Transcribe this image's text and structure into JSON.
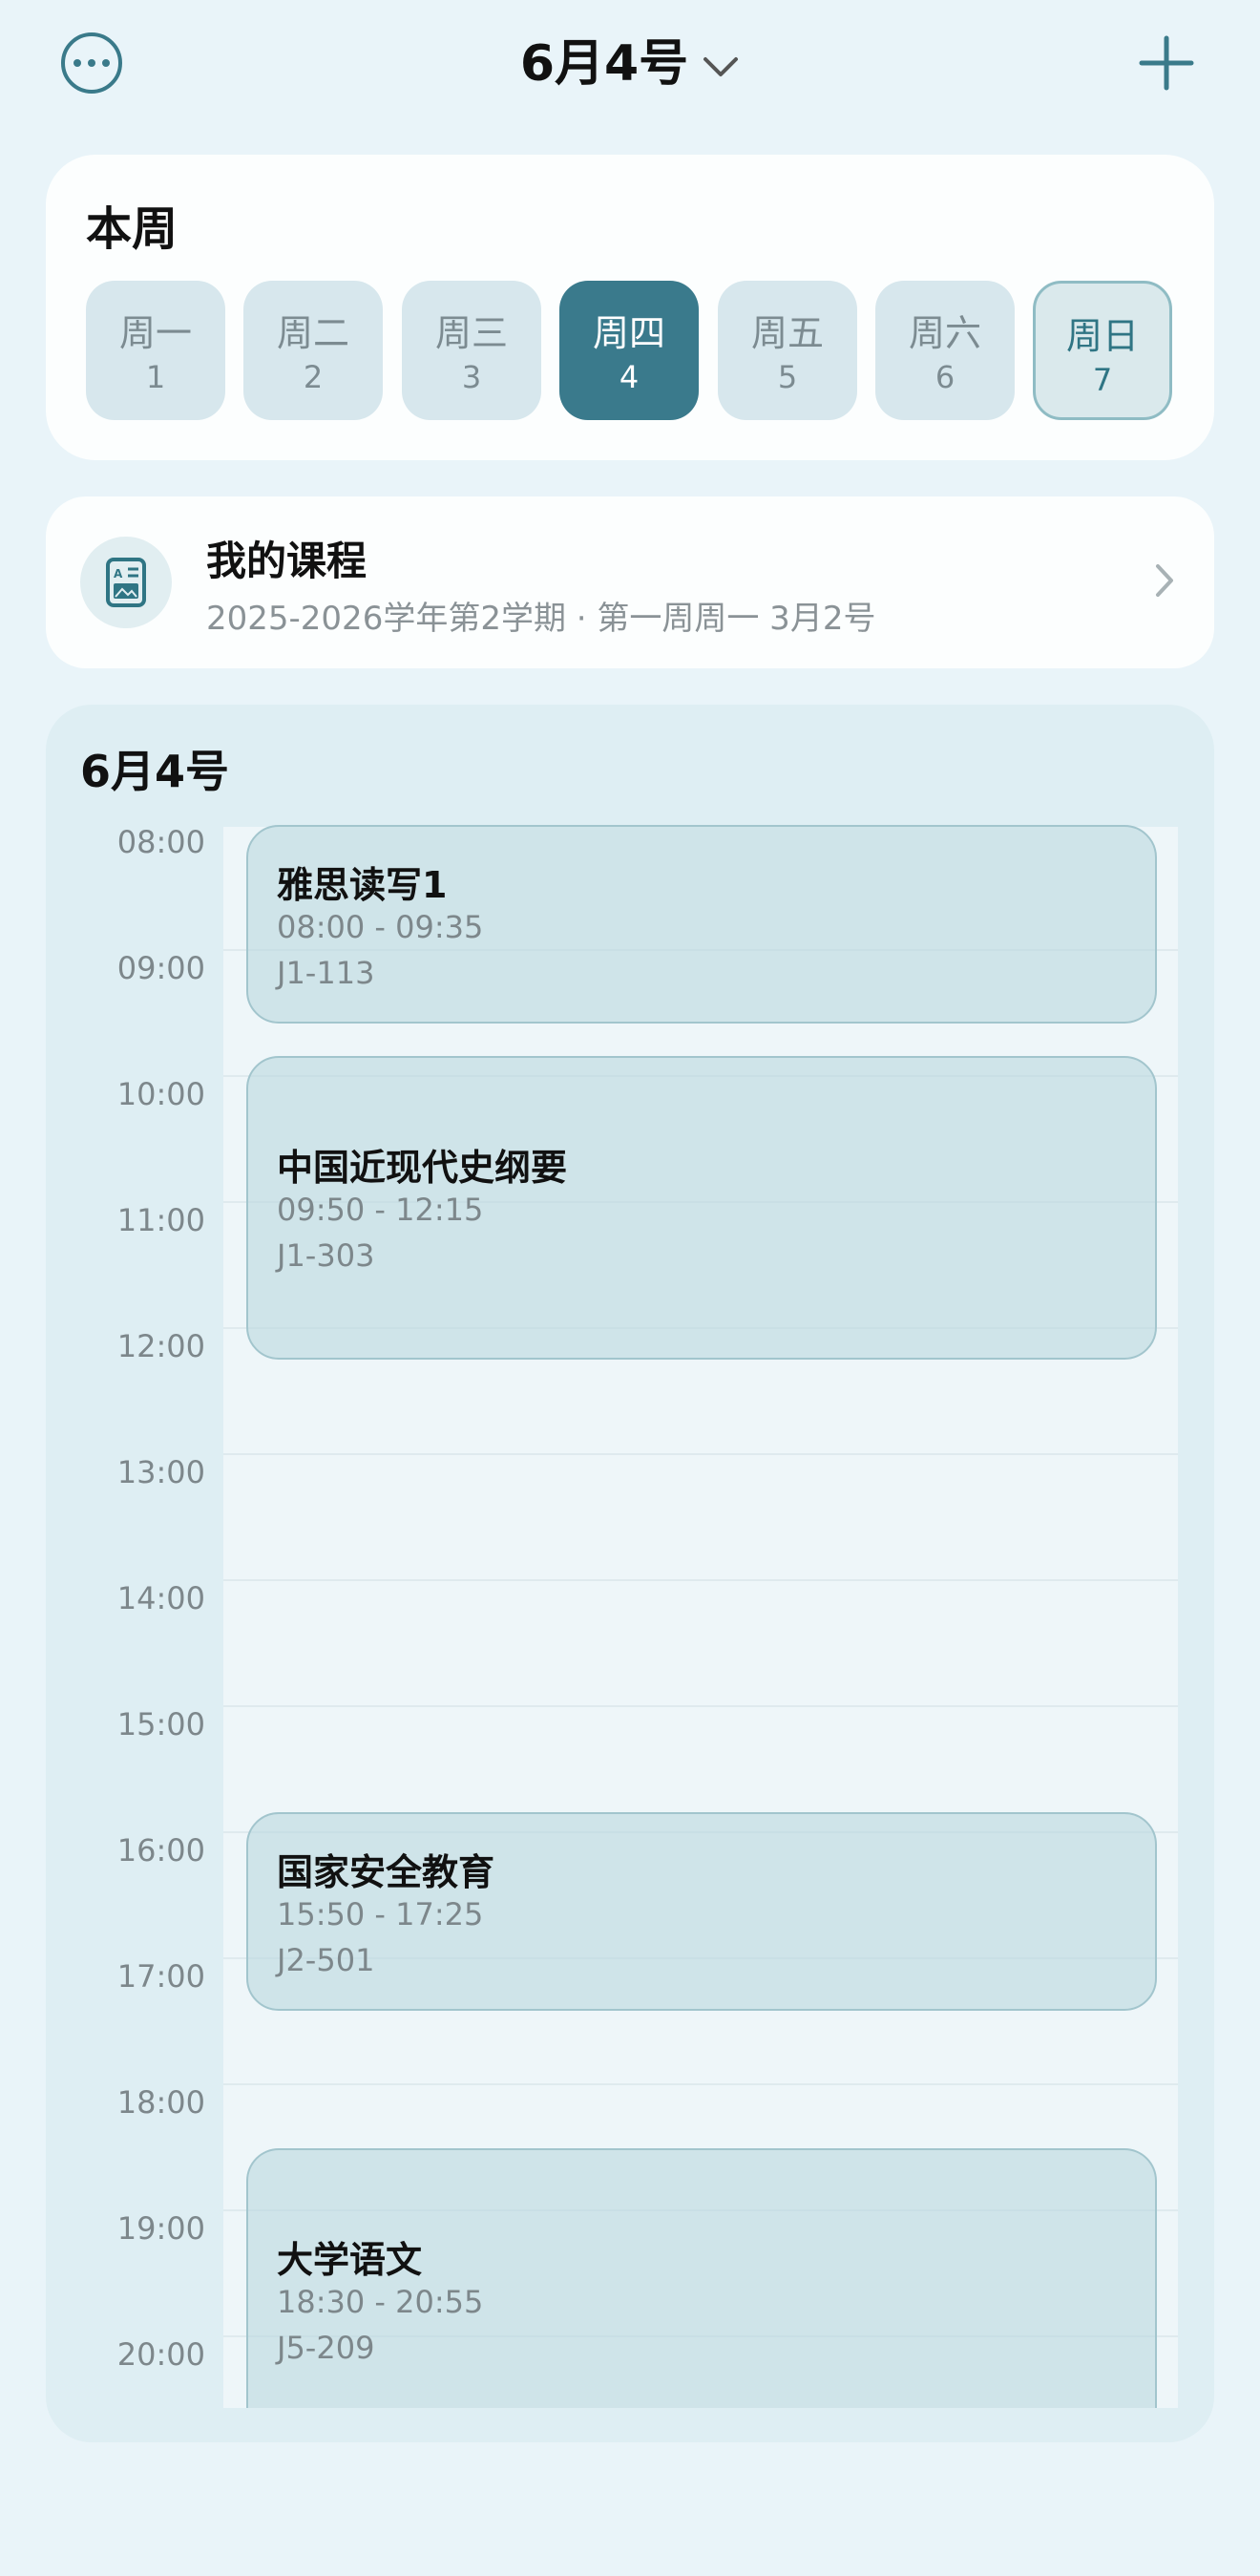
{
  "header": {
    "title": "6月4号",
    "more_icon": "more-circle-icon",
    "add_icon": "plus-icon",
    "dropdown_icon": "chevron-down-icon"
  },
  "week": {
    "title": "本周",
    "days": [
      {
        "name": "周一",
        "num": "1",
        "state": "normal"
      },
      {
        "name": "周二",
        "num": "2",
        "state": "normal"
      },
      {
        "name": "周三",
        "num": "3",
        "state": "normal"
      },
      {
        "name": "周四",
        "num": "4",
        "state": "selected"
      },
      {
        "name": "周五",
        "num": "5",
        "state": "normal"
      },
      {
        "name": "周六",
        "num": "6",
        "state": "normal"
      },
      {
        "name": "周日",
        "num": "7",
        "state": "today"
      }
    ]
  },
  "courses": {
    "title": "我的课程",
    "subtitle": "2025-2026学年第2学期 · 第一周周一 3月2号",
    "icon": "schedule-document-icon"
  },
  "schedule": {
    "date": "6月4号",
    "hours": [
      "08:00",
      "09:00",
      "10:00",
      "11:00",
      "12:00",
      "13:00",
      "14:00",
      "15:00",
      "16:00",
      "17:00",
      "18:00",
      "19:00",
      "20:00"
    ],
    "events": [
      {
        "name": "雅思读写1",
        "time": "08:00 - 09:35",
        "room": "J1-113"
      },
      {
        "name": "中国近现代史纲要",
        "time": "09:50 - 12:15",
        "room": "J1-303"
      },
      {
        "name": "国家安全教育",
        "time": "15:50 - 17:25",
        "room": "J2-501"
      },
      {
        "name": "大学语文",
        "time": "18:30 - 20:55",
        "room": "J5-209"
      }
    ]
  },
  "colors": {
    "background": "#e9f4f9",
    "accent": "#3a7a8c",
    "event_fill": "#c4dde2",
    "muted_text": "#7d878b"
  }
}
